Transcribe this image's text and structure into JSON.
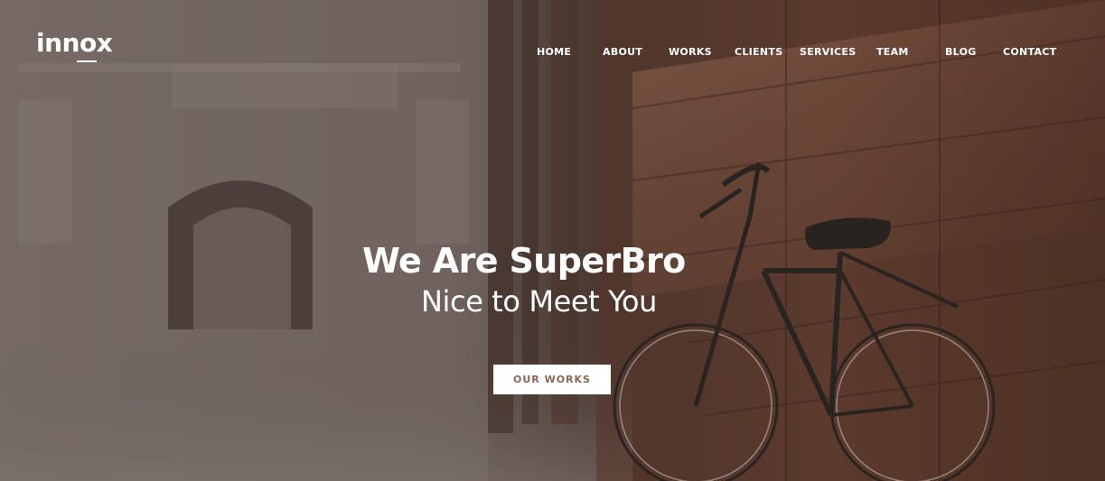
{
  "brand": {
    "logo_text": "innox"
  },
  "nav": {
    "items": [
      {
        "label": "HOME"
      },
      {
        "label": "ABOUT"
      },
      {
        "label": "WORKS"
      },
      {
        "label": "CLIENTS"
      },
      {
        "label": "SERVICES"
      },
      {
        "label": "TEAM"
      },
      {
        "label": "BLOG"
      },
      {
        "label": "CONTACT"
      }
    ]
  },
  "hero": {
    "headline": "We Are SuperBro",
    "subheadline": "Nice to Meet You",
    "cta_label": "OUR WORKS"
  },
  "colors": {
    "overlay": "#6a5a55",
    "cta_background": "#ffffff",
    "cta_text": "#8a6657",
    "text": "#ffffff"
  }
}
